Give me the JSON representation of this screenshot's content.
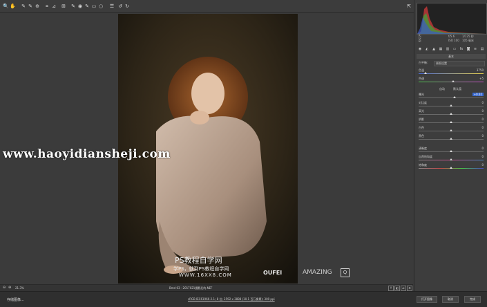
{
  "statusbar": {
    "zoom": "21.3%",
    "filename": "Bmd 03 - 2017021摄影后的.NEF"
  },
  "footer": {
    "left_button": "存储图像...",
    "info": "sRGB IEC61966-2.1; 8 位; 2592 x 3888 (10.1 百万像素); 300 ppi",
    "open_button": "打开图像",
    "cancel_button": "取消",
    "done_button": "完成"
  },
  "panel": {
    "hist_r": "R:",
    "hist_g": "G:",
    "hist_b": "B:",
    "hist_f": "f/5.6",
    "hist_shutter": "1/125 秒",
    "hist_iso": "ISO 100",
    "hist_focal": "105 毫米",
    "section_title": "基本",
    "treatment_label": "处理方式:",
    "treatment_color": "颜色",
    "treatment_bw": "黑白",
    "wb_label": "白平衡:",
    "wb_value": "原照设置",
    "temp_label": "色温",
    "temp_value": "3750",
    "tint_label": "色调",
    "tint_value": "+5",
    "auto_label": "自动",
    "default_label": "默认值",
    "exposure_label": "曝光",
    "exposure_value": "+0.65",
    "contrast_label": "对比度",
    "contrast_value": "0",
    "highlights_label": "高光",
    "highlights_value": "0",
    "shadows_label": "阴影",
    "shadows_value": "0",
    "whites_label": "白色",
    "whites_value": "0",
    "blacks_label": "黑色",
    "blacks_value": "0",
    "clarity_label": "清晰度",
    "clarity_value": "0",
    "vibrance_label": "自然饱和度",
    "vibrance_value": "0",
    "saturation_label": "饱和度",
    "saturation_value": "0"
  },
  "watermarks": {
    "site": "www.haoyidiansheji.com",
    "ps_title": "PS教程自学网",
    "ps_sub": "学PS，就到PS教程自学网",
    "ps_url": "WWW.16XX8.COM",
    "brand": "OUFEI",
    "amazing": "AMAZING"
  }
}
